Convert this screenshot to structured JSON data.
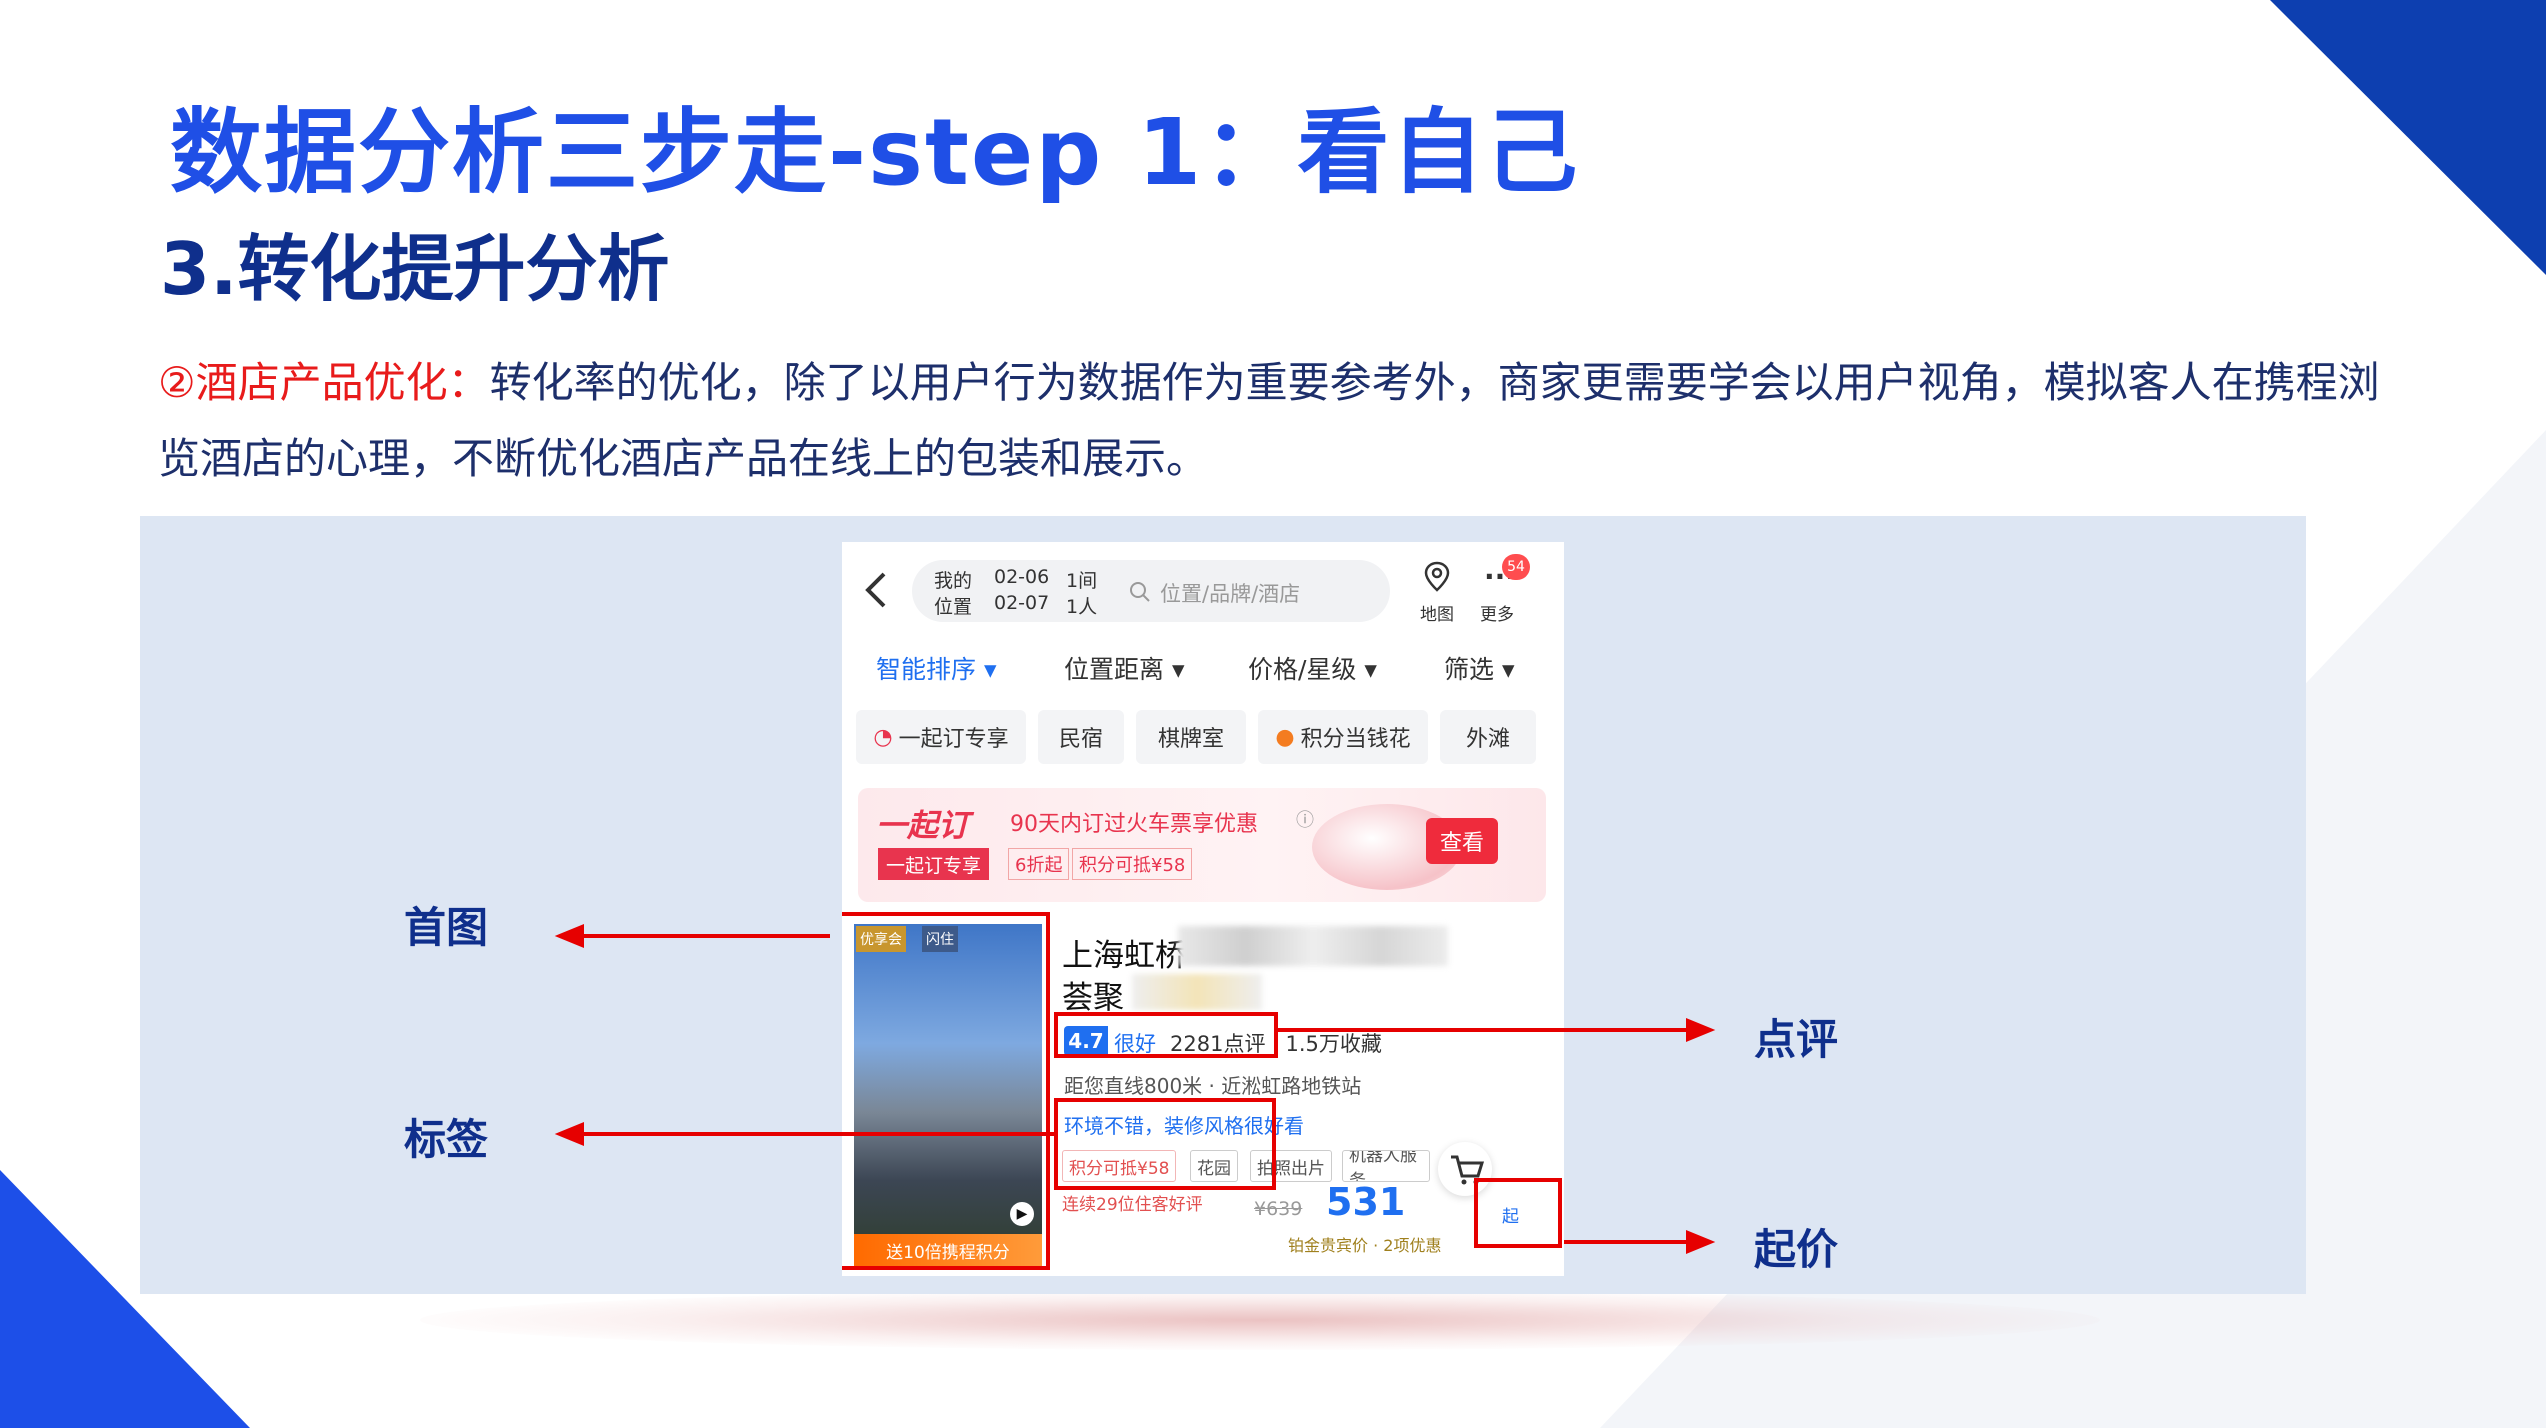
{
  "slide": {
    "title": "数据分析三步走-step 1：看自己",
    "subtitle": "3.转化提升分析",
    "para_highlight": "②酒店产品优化：",
    "para_body": "转化率的优化，除了以用户行为数据作为重要参考外，商家更需要学会以用户视角，模拟客人在携程浏览酒店的心理，不断优化酒店产品在线上的包装和展示。"
  },
  "callouts": {
    "first_image": "首图",
    "tags": "标签",
    "review": "点评",
    "start_price": "起价"
  },
  "colors": {
    "title_blue": "#1f4fe6",
    "dark_blue": "#0f2f8c",
    "highlight_red": "#e81b1b",
    "panel_bg": "#dde6f3",
    "callout_red": "#e60000"
  },
  "app": {
    "location_line1": "我的",
    "location_line2": "位置",
    "date_in": "02-06",
    "date_out": "02-07",
    "rooms": "1间",
    "guests": "1人",
    "search_placeholder": "位置/品牌/酒店",
    "map_label": "地图",
    "more_label": "更多",
    "more_badge": "54",
    "sort_tabs": [
      "智能排序",
      "位置距离",
      "价格/星级",
      "筛选"
    ],
    "chips": [
      "一起订专享",
      "民宿",
      "棋牌室",
      "积分当钱花",
      "外滩"
    ],
    "banner": {
      "brand": "一起订",
      "headline": "90天内订过火车票享优惠",
      "badge": "一起订专享",
      "discount": "6折起",
      "points": "积分可抵¥58",
      "button": "查看"
    },
    "hotel": {
      "image_badge1": "优享会",
      "image_badge2": "闪住",
      "image_promo": "送10倍携程积分",
      "name_line1": "上海虹桥",
      "name_line2": "荟聚",
      "score": "4.7",
      "score_word": "很好",
      "reviews": "2281点评 · 1.5万收藏",
      "distance": "距您直线800米 · 近淞虹路地铁站",
      "review_quote": "环境不错，装修风格很好看",
      "tags": [
        "积分可抵¥58",
        "花园",
        "拍照出片",
        "机器人服务"
      ],
      "recent": "连续29位住客好评",
      "original_price": "¥639",
      "price": "531",
      "price_suffix": "起",
      "member_line": "铂金贵宾价 · 2项优惠"
    }
  }
}
